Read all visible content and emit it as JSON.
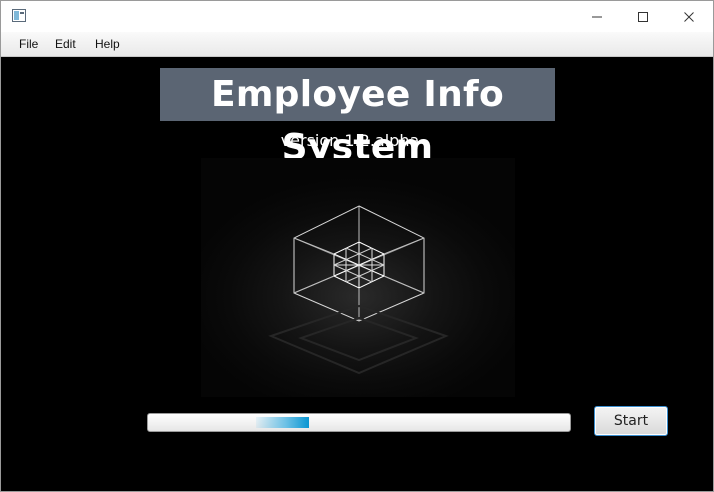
{
  "window": {
    "icon": "app-window-icon",
    "controls": [
      "minimize-icon",
      "maximize-icon",
      "close-icon"
    ]
  },
  "menubar": {
    "file": "File",
    "edit": "Edit",
    "help": "Help"
  },
  "main": {
    "title": "Employee Info System",
    "version": "version 1.2.alpha",
    "splash_icon": "wireframe-cube-icon",
    "progress_fraction": 0.38,
    "start_label": "Start"
  },
  "colors": {
    "banner": "#5b6573",
    "background": "#000000",
    "progress_accent": "#0a96d2",
    "button_focus": "#3b8fd0"
  }
}
